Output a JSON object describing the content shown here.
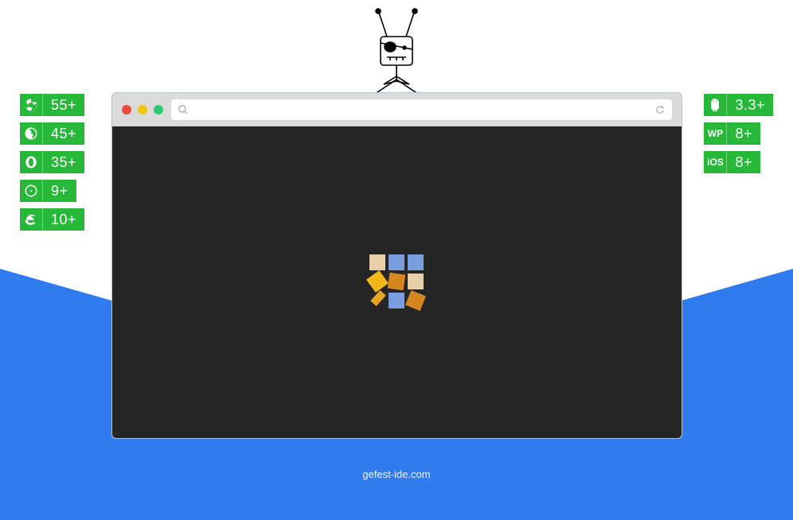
{
  "left_badges": [
    {
      "name": "chrome",
      "value": "55+"
    },
    {
      "name": "firefox",
      "value": "45+"
    },
    {
      "name": "opera",
      "value": "35+"
    },
    {
      "name": "safari",
      "value": "9+"
    },
    {
      "name": "ie",
      "value": "10+"
    }
  ],
  "right_badges": [
    {
      "name": "android",
      "value": "3.3+"
    },
    {
      "name": "wp",
      "value": "8+"
    },
    {
      "name": "ios",
      "value": "8+"
    }
  ],
  "footer": {
    "url": "gefest-ide.com"
  }
}
